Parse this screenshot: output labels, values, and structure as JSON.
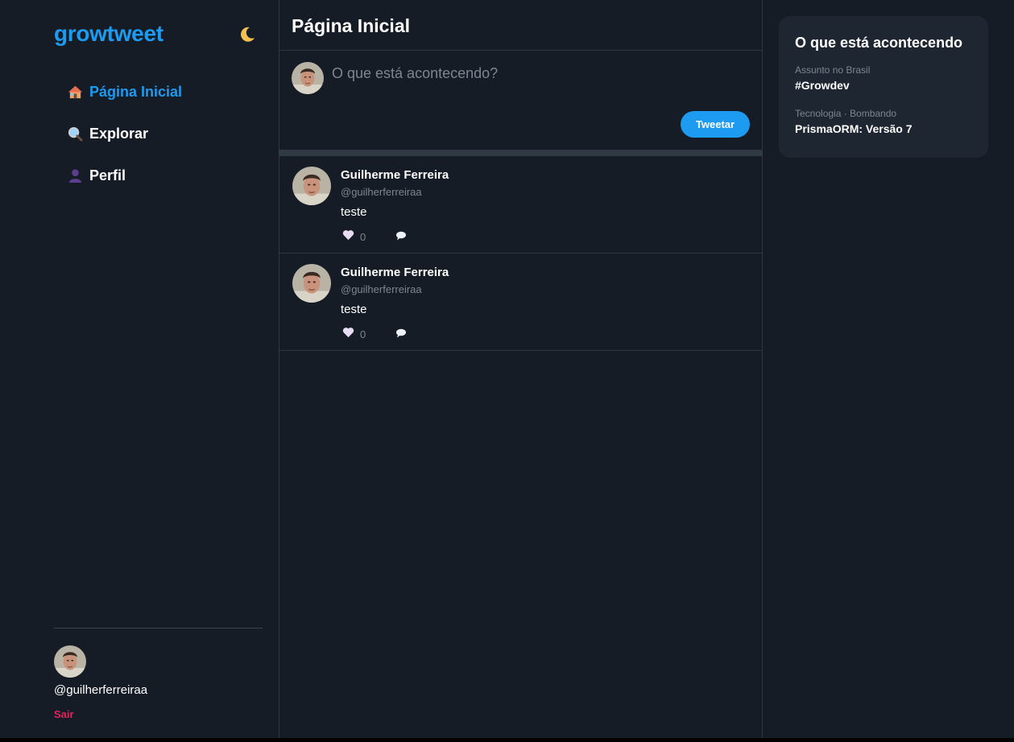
{
  "app": {
    "logo": "growtweet"
  },
  "sidebar": {
    "items": [
      {
        "label": "Página Inicial",
        "icon": "house-icon",
        "active": true
      },
      {
        "label": "Explorar",
        "icon": "magnifier-icon",
        "active": false
      },
      {
        "label": "Perfil",
        "icon": "user-silhouette-icon",
        "active": false
      }
    ],
    "user": {
      "handle": "@guilherferreiraa"
    },
    "logout_label": "Sair",
    "theme_icon": "crescent-moon-icon"
  },
  "main": {
    "title": "Página Inicial",
    "composer": {
      "placeholder": "O que está acontecendo?",
      "submit_label": "Tweetar"
    },
    "tweets": [
      {
        "name": "Guilherme Ferreira",
        "handle": "@guilherferreiraa",
        "text": "teste",
        "likes": "0"
      },
      {
        "name": "Guilherme Ferreira",
        "handle": "@guilherferreiraa",
        "text": "teste",
        "likes": "0"
      }
    ]
  },
  "trends": {
    "title": "O que está acontecendo",
    "items": [
      {
        "category": "Assunto no Brasil",
        "name": "#Growdev"
      },
      {
        "category": "Tecnologia · Bombando",
        "name": "PrismaORM: Versão 7"
      }
    ]
  },
  "colors": {
    "background": "#151c26",
    "accent": "#1d9bf0",
    "panel": "#1e2631",
    "logout": "#e0245e",
    "muted_text": "#7c8691"
  }
}
